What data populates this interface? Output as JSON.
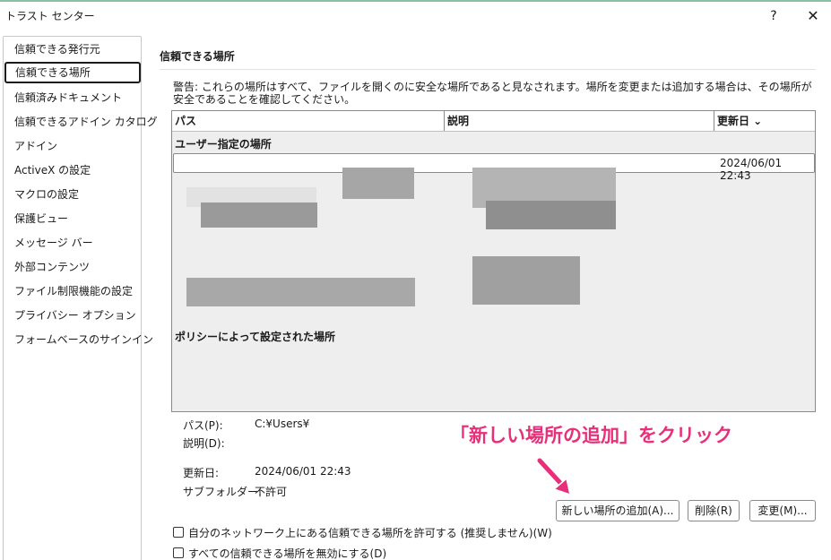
{
  "window": {
    "title": "トラスト センター",
    "help_label": "?",
    "close_label": "✕"
  },
  "sidebar": {
    "items": [
      {
        "label": "信頼できる発行元"
      },
      {
        "label": "信頼できる場所"
      },
      {
        "label": "信頼済みドキュメント"
      },
      {
        "label": "信頼できるアドイン カタログ"
      },
      {
        "label": "アドイン"
      },
      {
        "label": "ActiveX の設定"
      },
      {
        "label": "マクロの設定"
      },
      {
        "label": "保護ビュー"
      },
      {
        "label": "メッセージ バー"
      },
      {
        "label": "外部コンテンツ"
      },
      {
        "label": "ファイル制限機能の設定"
      },
      {
        "label": "プライバシー オプション"
      },
      {
        "label": "フォームベースのサインイン"
      }
    ],
    "selected_index": 1
  },
  "main": {
    "title": "信頼できる場所",
    "warning": "警告: これらの場所はすべて、ファイルを開くのに安全な場所であると見なされます。場所を変更または追加する場合は、その場所が安全であることを確認してください。",
    "table": {
      "columns": [
        "パス",
        "説明",
        "更新日 ⌄"
      ],
      "user_group": "ユーザー指定の場所",
      "selected_row_date": "2024/06/01 22:43",
      "policy_group": "ポリシーによって設定された場所"
    },
    "details": {
      "path_label": "パス(P):",
      "path_value": "C:¥Users¥",
      "description_label": "説明(D):",
      "modified_label": "更新日:",
      "modified_value": "2024/06/01 22:43",
      "subfolders_label": "サブフォルダー:",
      "subfolders_value": "不許可"
    },
    "buttons": {
      "add": "新しい場所の追加(A)...",
      "remove": "削除(R)",
      "modify": "変更(M)..."
    },
    "checkboxes": {
      "allow_network": "自分のネットワーク上にある信頼できる場所を許可する (推奨しません)(W)",
      "disable_all": "すべての信頼できる場所を無効にする(D)"
    }
  },
  "annotation": {
    "text": "「新しい場所の追加」をクリック",
    "color": "#e8307a"
  }
}
